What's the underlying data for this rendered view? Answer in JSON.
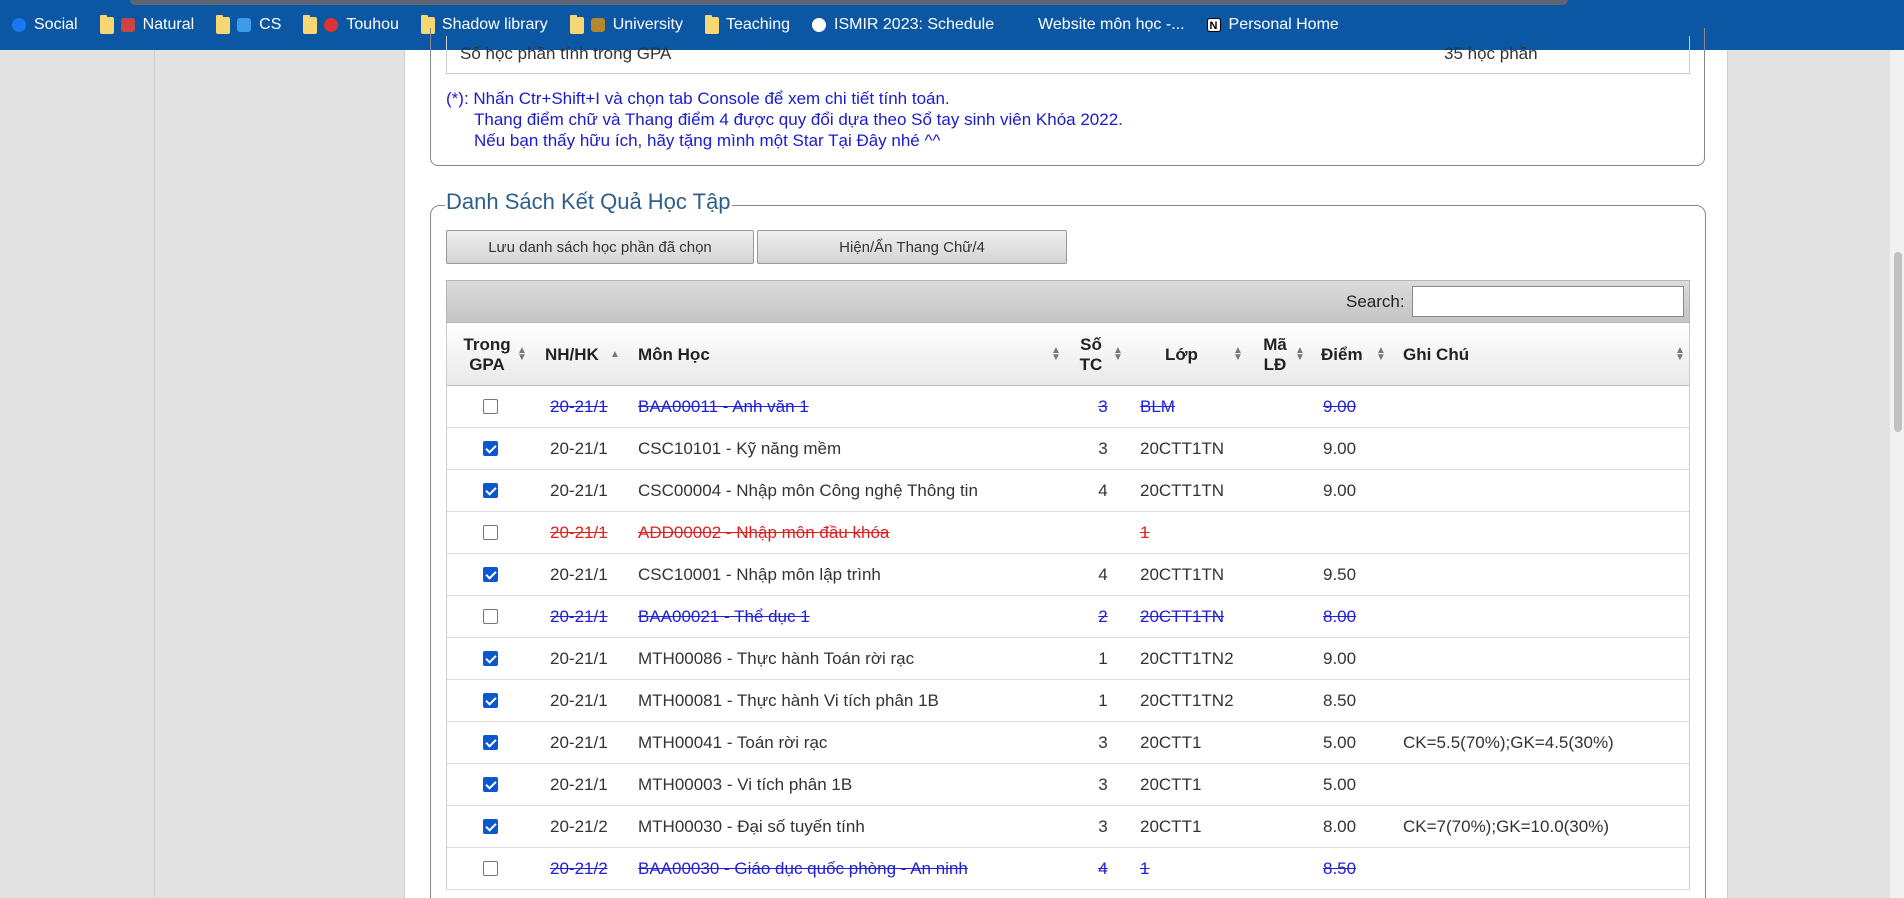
{
  "bookmarks": [
    {
      "label": "Social",
      "icon": "facebook-icon",
      "kind": "site"
    },
    {
      "label": "Natural",
      "icon": "folder-icon",
      "kind": "folder"
    },
    {
      "label": "CS",
      "icon": "folder-icon",
      "kind": "folder"
    },
    {
      "label": "Touhou",
      "icon": "folder-icon",
      "kind": "folder"
    },
    {
      "label": "Shadow library",
      "icon": "folder-icon",
      "kind": "folder"
    },
    {
      "label": "University",
      "icon": "folder-icon",
      "kind": "folder"
    },
    {
      "label": "Teaching",
      "icon": "folder-icon",
      "kind": "folder"
    },
    {
      "label": "ISMIR 2023: Schedule",
      "icon": "globe-icon",
      "kind": "site"
    },
    {
      "label": "Website môn học -...",
      "icon": "site-icon",
      "kind": "site"
    },
    {
      "label": "Personal Home",
      "icon": "notion-icon",
      "kind": "site"
    }
  ],
  "summary": {
    "gpa_courses_label": "Số học phần tính trong GPA",
    "gpa_courses_value": "35 học phần"
  },
  "notes": {
    "line1": "(*): Nhấn Ctr+Shift+I và chọn tab Console để xem chi tiết tính toán.",
    "line2": "Thang điểm chữ và Thang điểm 4 được quy đổi dựa theo Sổ tay sinh viên Khóa 2022.",
    "line3": "Nếu bạn thấy hữu ích, hãy tặng mình một Star Tại Đây nhé ^^"
  },
  "results": {
    "legend": "Danh Sách Kết Quả Học Tập",
    "save_button": "Lưu danh sách học phần đã chọn",
    "toggle_button": "Hiện/Ẩn Thang Chữ/4",
    "search_label": "Search:",
    "search_value": "",
    "headers": {
      "in_gpa_1": "Trong",
      "in_gpa_2": "GPA",
      "term": "NH/HK",
      "course": "Môn Học",
      "credits_1": "Số",
      "credits_2": "TC",
      "class": "Lớp",
      "code_1": "Mã",
      "code_2": "LĐ",
      "grade": "Điểm",
      "note": "Ghi Chú"
    },
    "rows": [
      {
        "checked": false,
        "style": "excluded",
        "term": "20-21/1",
        "course": "BAA00011 - Anh văn 1",
        "credits": "3",
        "class": "BLM",
        "grade": "9.00",
        "note": ""
      },
      {
        "checked": true,
        "style": "normal",
        "term": "20-21/1",
        "course": "CSC10101 - Kỹ năng mềm",
        "credits": "3",
        "class": "20CTT1TN",
        "grade": "9.00",
        "note": ""
      },
      {
        "checked": true,
        "style": "normal",
        "term": "20-21/1",
        "course": "CSC00004 - Nhập môn Công nghệ Thông tin",
        "credits": "4",
        "class": "20CTT1TN",
        "grade": "9.00",
        "note": ""
      },
      {
        "checked": false,
        "style": "excluded-red",
        "term": "20-21/1",
        "course": "ADD00002 - Nhập môn đầu khóa",
        "credits": "",
        "class": "1",
        "grade": "",
        "note": ""
      },
      {
        "checked": true,
        "style": "normal",
        "term": "20-21/1",
        "course": "CSC10001 - Nhập môn lập trình",
        "credits": "4",
        "class": "20CTT1TN",
        "grade": "9.50",
        "note": ""
      },
      {
        "checked": false,
        "style": "excluded",
        "term": "20-21/1",
        "course": "BAA00021 - Thể dục 1",
        "credits": "2",
        "class": "20CTT1TN",
        "grade": "8.00",
        "note": ""
      },
      {
        "checked": true,
        "style": "normal",
        "term": "20-21/1",
        "course": "MTH00086 - Thực hành Toán rời rạc",
        "credits": "1",
        "class": "20CTT1TN2",
        "grade": "9.00",
        "note": ""
      },
      {
        "checked": true,
        "style": "normal",
        "term": "20-21/1",
        "course": "MTH00081 - Thực hành Vi tích phân 1B",
        "credits": "1",
        "class": "20CTT1TN2",
        "grade": "8.50",
        "note": ""
      },
      {
        "checked": true,
        "style": "normal",
        "term": "20-21/1",
        "course": "MTH00041 - Toán rời rạc",
        "credits": "3",
        "class": "20CTT1",
        "grade": "5.00",
        "note": "CK=5.5(70%);GK=4.5(30%)"
      },
      {
        "checked": true,
        "style": "normal",
        "term": "20-21/1",
        "course": "MTH00003 - Vi tích phân 1B",
        "credits": "3",
        "class": "20CTT1",
        "grade": "5.00",
        "note": ""
      },
      {
        "checked": true,
        "style": "normal",
        "term": "20-21/2",
        "course": "MTH00030 - Đại số tuyến tính",
        "credits": "3",
        "class": "20CTT1",
        "grade": "8.00",
        "note": "CK=7(70%);GK=10.0(30%)"
      },
      {
        "checked": false,
        "style": "excluded",
        "term": "20-21/2",
        "course": "BAA00030 - Giáo dục quốc phòng - An ninh",
        "credits": "4",
        "class": "1",
        "grade": "8.50",
        "note": ""
      }
    ]
  }
}
